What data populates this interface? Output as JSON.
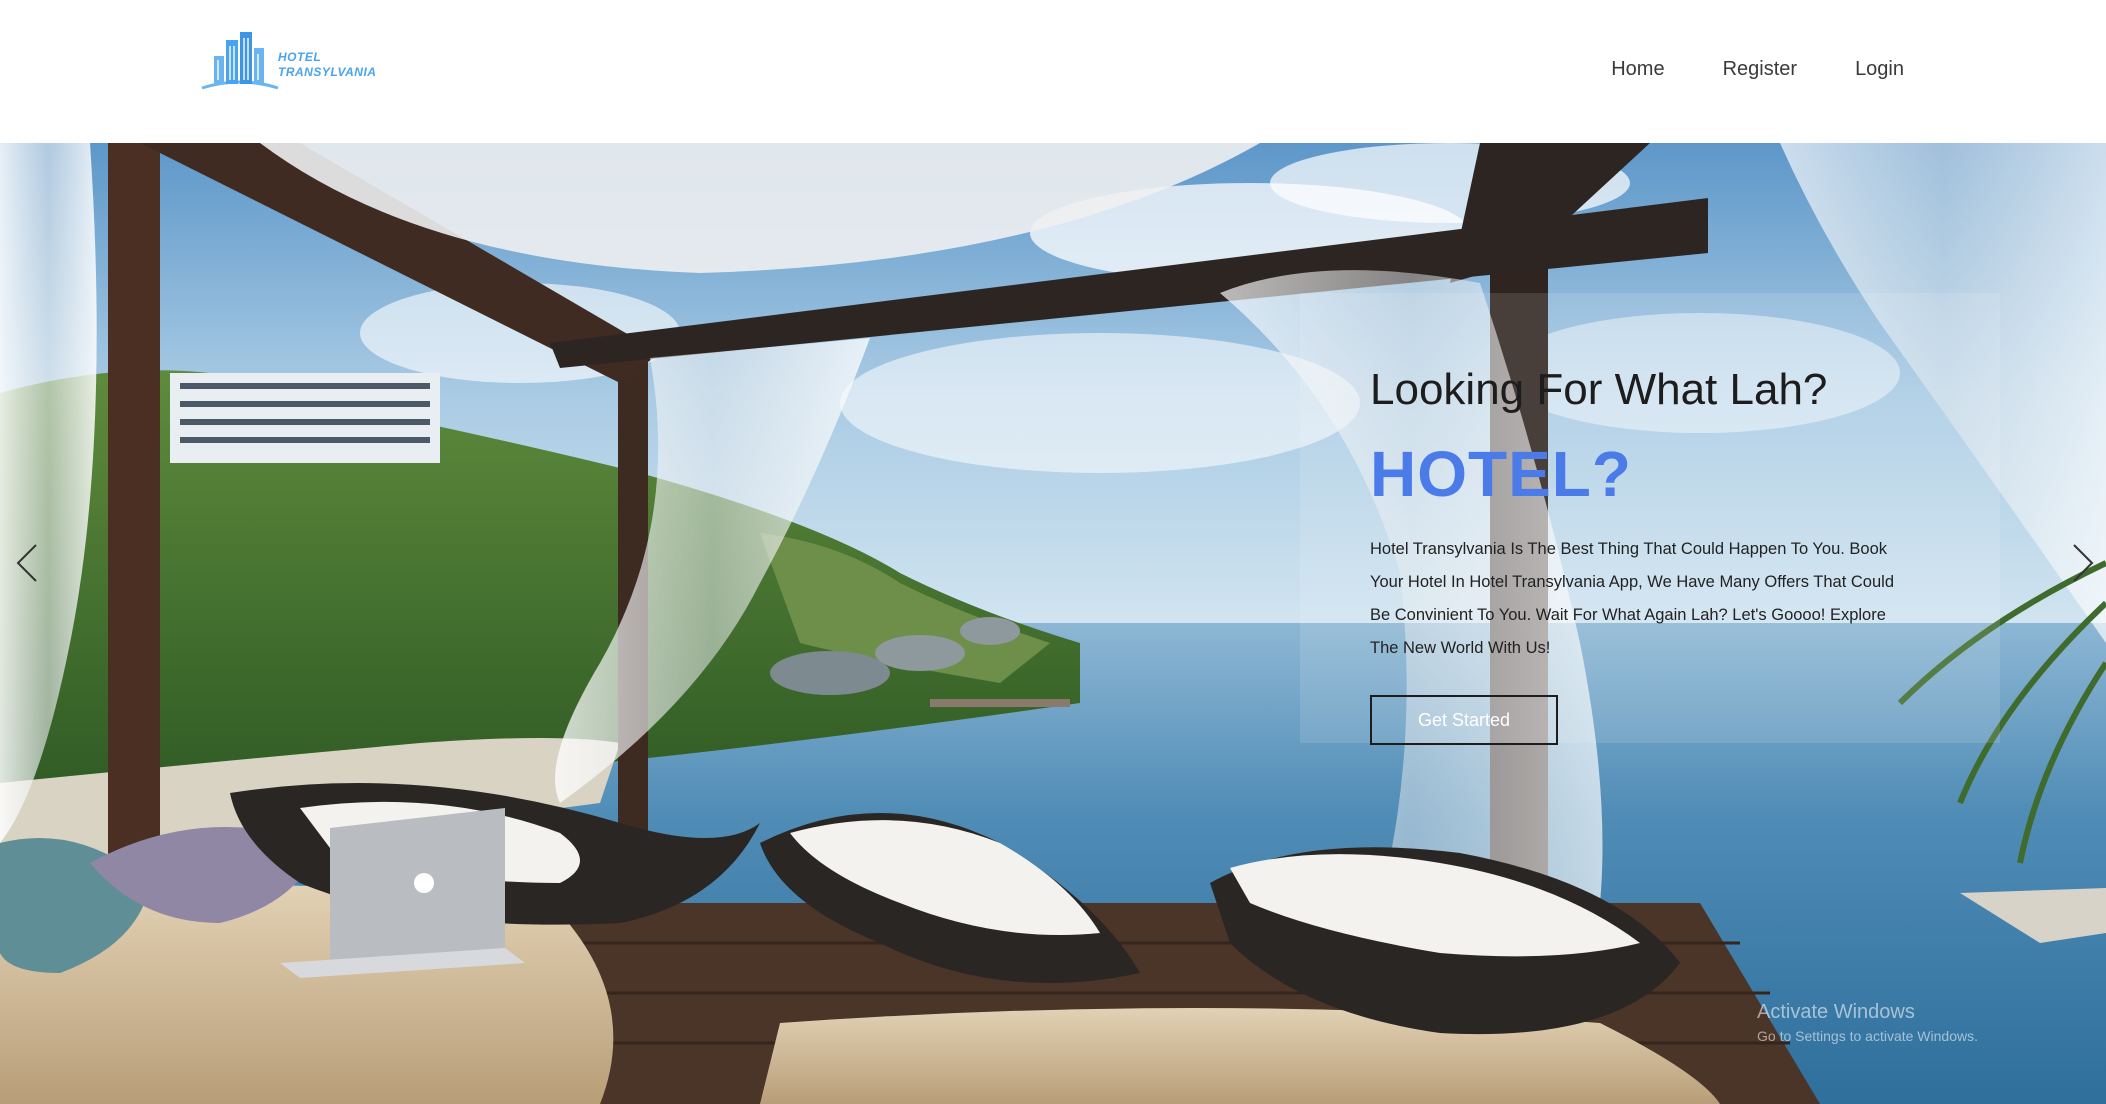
{
  "brand": {
    "line1": "HOTEL",
    "line2": "TRANSYLVANIA",
    "color": "#4aa3f0"
  },
  "nav": {
    "home": "Home",
    "register": "Register",
    "login": "Login"
  },
  "hero": {
    "subtitle": "Looking For What Lah?",
    "title": "HOTEL?",
    "description": "Hotel Transylvania Is The Best Thing That Could Happen To You. Book Your Hotel In Hotel Transylvania App, We Have Many Offers That Could Be Convinient To You. Wait For What Again Lah? Let's Goooo! Explore The New World With Us!",
    "cta_label": "Get Started",
    "accent_color": "#4a7be8"
  },
  "carousel": {
    "prev_icon": "chevron-left-icon",
    "next_icon": "chevron-right-icon"
  },
  "watermark": {
    "line1": "Activate Windows",
    "line2": "Go to Settings to activate Windows."
  }
}
